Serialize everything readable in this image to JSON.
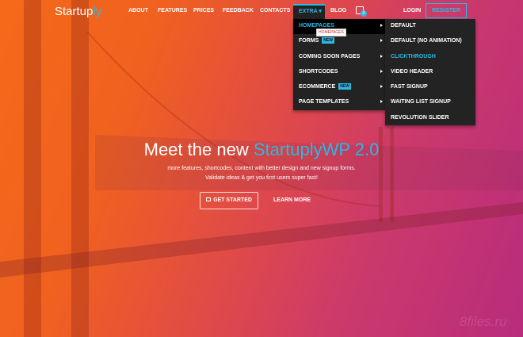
{
  "nav": {
    "logo_main": "Startup",
    "logo_accent": "ly",
    "items": [
      "ABOUT",
      "FEATURES",
      "PRICES",
      "FEEDBACK",
      "CONTACTS"
    ],
    "extra": "EXTRA ▾",
    "blog": "BLOG",
    "cart_count": "0",
    "login": "LOGIN",
    "register": "REGISTER"
  },
  "menu": {
    "items": [
      {
        "label": "HOMEPAGES"
      },
      {
        "label": "FORMS",
        "badge": "NEW"
      },
      {
        "label": "COMING SOON PAGES"
      },
      {
        "label": "SHORTCODES"
      },
      {
        "label": "ECOMMERCE",
        "badge": "NEW"
      },
      {
        "label": "PAGE TEMPLATES"
      }
    ],
    "tooltip": "HOMEPAGES",
    "submenu": [
      "DEFAULT",
      "DEFAULT (NO ANIMATION)",
      "CLICKTHROUGH",
      "VIDEO HEADER",
      "FAST SIGNUP",
      "WAITING LIST SIGNUP",
      "REVOLUTION SLIDER"
    ]
  },
  "hero": {
    "title_main": "Meet the new ",
    "title_accent": "StartuplyWP 2.0",
    "line1": "more features, shortcodes, content with better design and new signup forms.",
    "line2": "Validate ideas & get you first users super fast!",
    "get_started": "GET STARTED",
    "learn_more": "LEARN MORE"
  },
  "watermark": "8files.ru",
  "colors": {
    "accent": "#2bb8e6",
    "menu_bg": "#232323"
  }
}
